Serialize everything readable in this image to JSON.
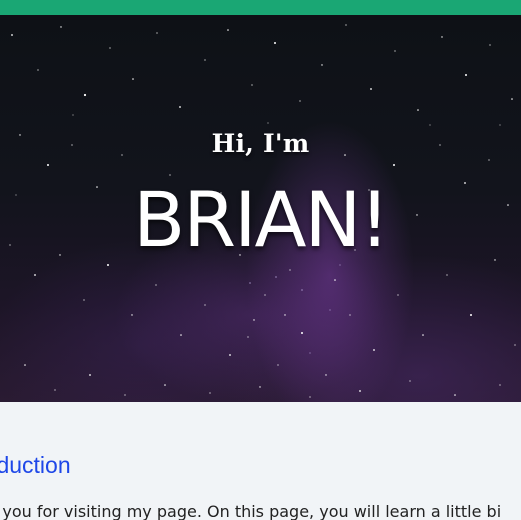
{
  "colors": {
    "top_bar": "#1aa774",
    "heading": "#1e47e8",
    "page_bg": "#f1f4f7"
  },
  "hero": {
    "greeting": "Hi, I'm",
    "name": "BRIAN!"
  },
  "intro": {
    "heading": "roduction",
    "text": "k you for visiting my page. On this page, you will learn a little bi"
  }
}
